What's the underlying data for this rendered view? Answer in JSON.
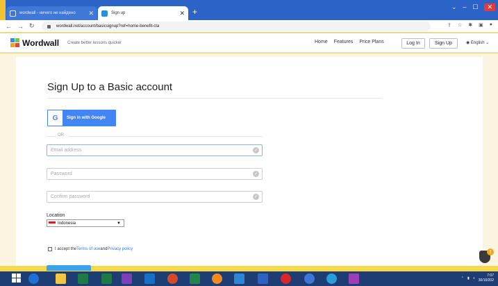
{
  "browser": {
    "tabs": [
      {
        "label": "wordwall - ничего не найдено",
        "active": false
      },
      {
        "label": "Sign up",
        "active": true
      }
    ],
    "new_tab": "+",
    "url": "wordwall.net/account/basicsignup?ref=home-benefit-cta",
    "window_controls": {
      "minimize": "–",
      "maximize": "☐",
      "close": "✕",
      "menu": "⌄"
    }
  },
  "site_header": {
    "logo": "Wordwall",
    "tagline": "Create better lessons quicker",
    "nav": [
      "Home",
      "Features",
      "Price Plans"
    ],
    "login": "Log In",
    "signup": "Sign Up",
    "language": "English"
  },
  "form": {
    "title": "Sign Up to a Basic account",
    "google_button": "Sign in with Google",
    "google_letter": "G",
    "or": "OR",
    "email_placeholder": "Email address",
    "password_placeholder": "Password",
    "confirm_placeholder": "Confirm password",
    "location_label": "Location",
    "location_value": "Indonesia",
    "terms": {
      "prefix": "I accept the ",
      "terms_link": "Terms of use",
      "and": " and ",
      "privacy_link": "Privacy policy"
    }
  },
  "taskbar": {
    "time": "7:07",
    "date": "30/10/202"
  },
  "colors": {
    "accent": "#4285f4",
    "tabstrip": "#2c63c7",
    "taskbar": "#1f3d75",
    "link": "#2f7bd8"
  }
}
